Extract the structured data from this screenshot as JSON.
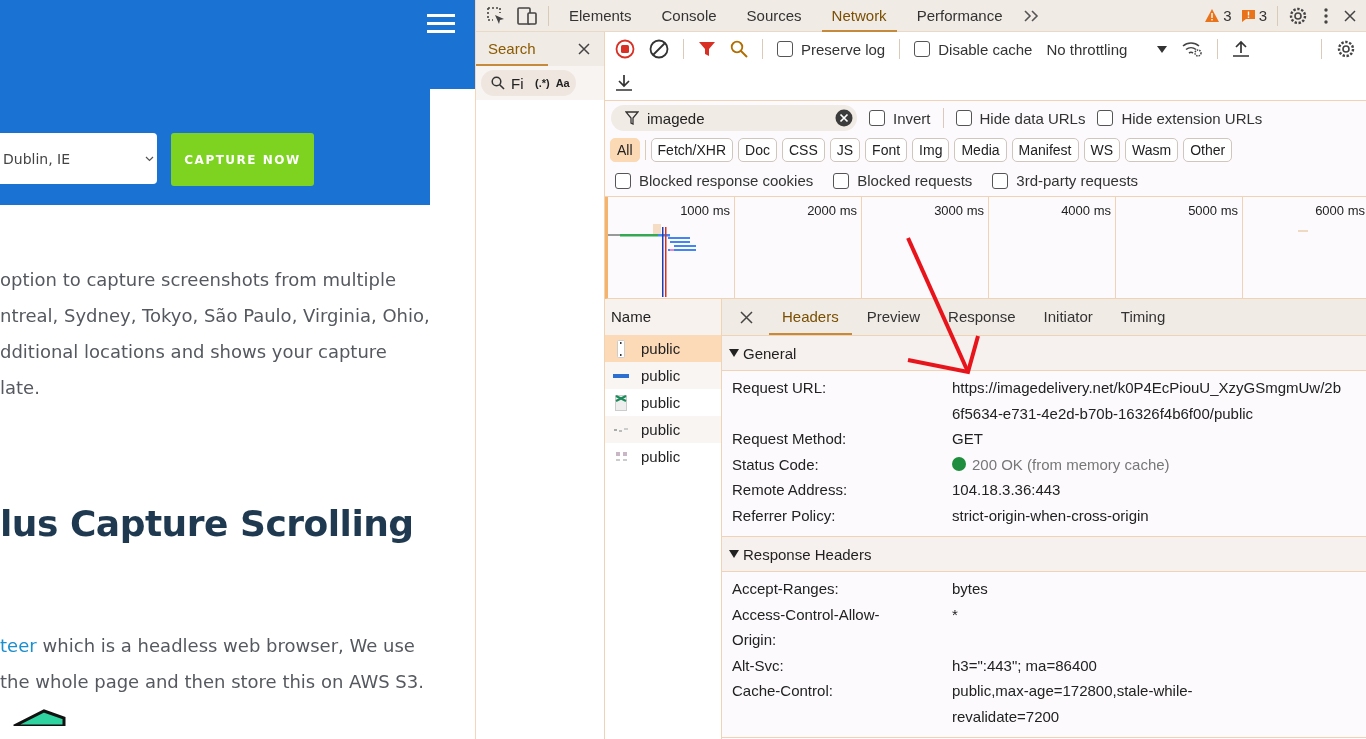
{
  "website": {
    "location_select": {
      "value": "Dublin, IE"
    },
    "capture_button": "CAPTURE NOW",
    "intro_lines": [
      "option to capture screenshots from multiple",
      "ntreal, Sydney, Tokyo, São Paulo, Virginia, Ohio,",
      "dditional locations and shows your capture",
      "late."
    ],
    "heading": "lus Capture Scrolling",
    "body_lines": [
      {
        "link": "teer",
        "text": "which is a headless web browser, We use"
      },
      {
        "text": "the whole page and then store this on AWS S3."
      }
    ]
  },
  "devtools": {
    "panel_tabs": [
      {
        "label": "Elements",
        "selected": false
      },
      {
        "label": "Console",
        "selected": false
      },
      {
        "label": "Sources",
        "selected": false
      },
      {
        "label": "Network",
        "selected": true
      },
      {
        "label": "Performance",
        "selected": false
      }
    ],
    "warnings": "3",
    "issues": "3",
    "drawer": {
      "tab": "Search",
      "placeholder": "Fi",
      "regex": "(.*)",
      "match_case": "Aa"
    },
    "toolbar": {
      "recording": true,
      "preserve_log": {
        "label": "Preserve log",
        "checked": false
      },
      "disable_cache": {
        "label": "Disable cache",
        "checked": false
      },
      "throttling": "No throttling"
    },
    "filter": {
      "value": "imagede",
      "options": [
        {
          "label": "Invert",
          "checked": false
        },
        {
          "label": "Hide data URLs",
          "checked": false
        },
        {
          "label": "Hide extension URLs",
          "checked": false
        }
      ]
    },
    "type_filters": [
      {
        "label": "All",
        "selected": true
      },
      {
        "label": "Fetch/XHR",
        "selected": false
      },
      {
        "label": "Doc",
        "selected": false
      },
      {
        "label": "CSS",
        "selected": false
      },
      {
        "label": "JS",
        "selected": false
      },
      {
        "label": "Font",
        "selected": false
      },
      {
        "label": "Img",
        "selected": false
      },
      {
        "label": "Media",
        "selected": false
      },
      {
        "label": "Manifest",
        "selected": false
      },
      {
        "label": "WS",
        "selected": false
      },
      {
        "label": "Wasm",
        "selected": false
      },
      {
        "label": "Other",
        "selected": false
      }
    ],
    "more_filters": [
      {
        "label": "Blocked response cookies",
        "checked": false
      },
      {
        "label": "Blocked requests",
        "checked": false
      },
      {
        "label": "3rd-party requests",
        "checked": false
      }
    ],
    "overview": {
      "ticks": [
        "1000 ms",
        "2000 ms",
        "3000 ms",
        "4000 ms",
        "5000 ms",
        "6000 ms"
      ]
    },
    "requests": {
      "column": "Name",
      "rows": [
        {
          "name": "public",
          "selected": true
        },
        {
          "name": "public",
          "selected": false
        },
        {
          "name": "public",
          "selected": false
        },
        {
          "name": "public",
          "selected": false
        },
        {
          "name": "public",
          "selected": false
        }
      ]
    },
    "details": {
      "tabs": [
        {
          "label": "Headers",
          "selected": true
        },
        {
          "label": "Preview",
          "selected": false
        },
        {
          "label": "Response",
          "selected": false
        },
        {
          "label": "Initiator",
          "selected": false
        },
        {
          "label": "Timing",
          "selected": false
        }
      ],
      "sections": [
        {
          "title": "General",
          "expanded": true,
          "rows": [
            {
              "key": [
                "Request URL:"
              ],
              "value": [
                "https://imagedelivery.net/k0P4EcPiouU_XzyGSmgmUw/2b",
                "6f5634-e731-4e2d-b70b-16326f4b6f00/public"
              ]
            },
            {
              "key": [
                "Request Method:"
              ],
              "value": [
                "GET"
              ]
            },
            {
              "key": [
                "Status Code:"
              ],
              "value": [
                "200 OK (from memory cache)"
              ],
              "color": "#1e8e3e"
            },
            {
              "key": [
                "Remote Address:"
              ],
              "value": [
                "104.18.3.36:443"
              ]
            },
            {
              "key": [
                "Referrer Policy:"
              ],
              "value": [
                "strict-origin-when-cross-origin"
              ]
            }
          ]
        },
        {
          "title": "Response Headers",
          "expanded": true,
          "rows": [
            {
              "key": [
                "Accept-Ranges:"
              ],
              "value": [
                "bytes"
              ]
            },
            {
              "key": [
                "Access-Control-Allow-",
                "Origin:"
              ],
              "value": [
                "*"
              ]
            },
            {
              "key": [
                "Alt-Svc:"
              ],
              "value": [
                "h3=\":443\"; ma=86400"
              ]
            },
            {
              "key": [
                "Cache-Control:"
              ],
              "value": [
                "public,max-age=172800,stale-while-",
                "revalidate=7200"
              ]
            }
          ]
        }
      ]
    }
  }
}
